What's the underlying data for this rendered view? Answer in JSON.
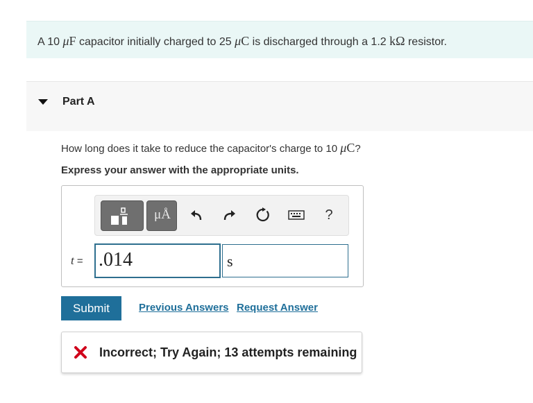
{
  "problem": {
    "text_1": "A 10",
    "unit_1_sym": "μ",
    "unit_1_letter": "F",
    "text_2": "capacitor initially charged to 25",
    "unit_2_sym": "μ",
    "unit_2_letter": "C",
    "text_3": "is discharged through a 1.2",
    "unit_3": "kΩ",
    "text_4": "resistor."
  },
  "part": {
    "title": "Part A"
  },
  "question": {
    "text": "How long does it take to reduce the capacitor's charge to 10",
    "unit_sym": "μ",
    "unit_letter": "C",
    "end": "?",
    "instruction": "Express your answer with the appropriate units."
  },
  "toolbar": {
    "units_button_label": "μÅ",
    "help_label": "?"
  },
  "answer": {
    "variable": "t",
    "equals": "=",
    "value": ".014",
    "unit": "s"
  },
  "actions": {
    "submit_label": "Submit",
    "previous_answers_label": "Previous Answers",
    "request_answer_label": "Request Answer"
  },
  "feedback": {
    "text": "Incorrect; Try Again; 13 attempts remaining",
    "status_color": "#d0021b"
  },
  "colors": {
    "accent": "#1f6f9a",
    "problem_bg": "#eaf7f6"
  }
}
